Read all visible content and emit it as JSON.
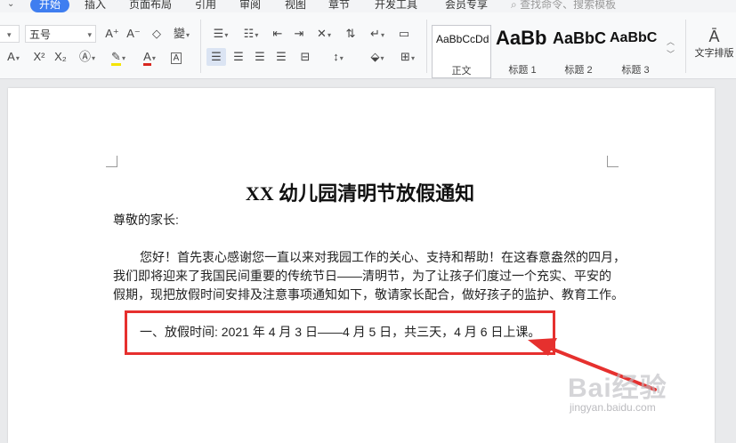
{
  "tabs": {
    "home": "开始",
    "insert": "插入",
    "layout": "页面布局",
    "references": "引用",
    "review": "审阅",
    "view": "视图",
    "section": "章节",
    "developer": "开发工具",
    "member": "会员专享",
    "search_placeholder": "查找命令、搜索模板"
  },
  "ribbon": {
    "font_size": "五号",
    "styles": {
      "normal": {
        "sample": "AaBbCcDd",
        "name": "正文"
      },
      "h1": {
        "sample": "AaBb",
        "name": "标题 1"
      },
      "h2": {
        "sample": "AaBbC",
        "name": "标题 2"
      },
      "h3": {
        "sample": "AaBbC",
        "name": "标题 3"
      }
    },
    "text_layout": "文字排版"
  },
  "document": {
    "title": "XX 幼儿园清明节放假通知",
    "salutation": "尊敬的家长:",
    "body_line1": "您好！首先衷心感谢您一直以来对我园工作的关心、支持和帮助！在这春意盎然的四月，",
    "body_line2": "我们即将迎来了我国民间重要的传统节日——清明节，为了让孩子们度过一个充实、平安的",
    "body_line3": "假期，现把放假时间安排及注意事项通知如下，敬请家长配合，做好孩子的监护、教育工作。",
    "holiday_line": "一、放假时间: 2021 年 4 月 3 日——4 月 5 日，共三天，4 月 6 日上课。"
  },
  "watermark": {
    "brand": "Bai经验",
    "url": "jingyan.baidu.com"
  },
  "colors": {
    "accent": "#3f7ef0",
    "highlight_red": "#e6302e"
  }
}
